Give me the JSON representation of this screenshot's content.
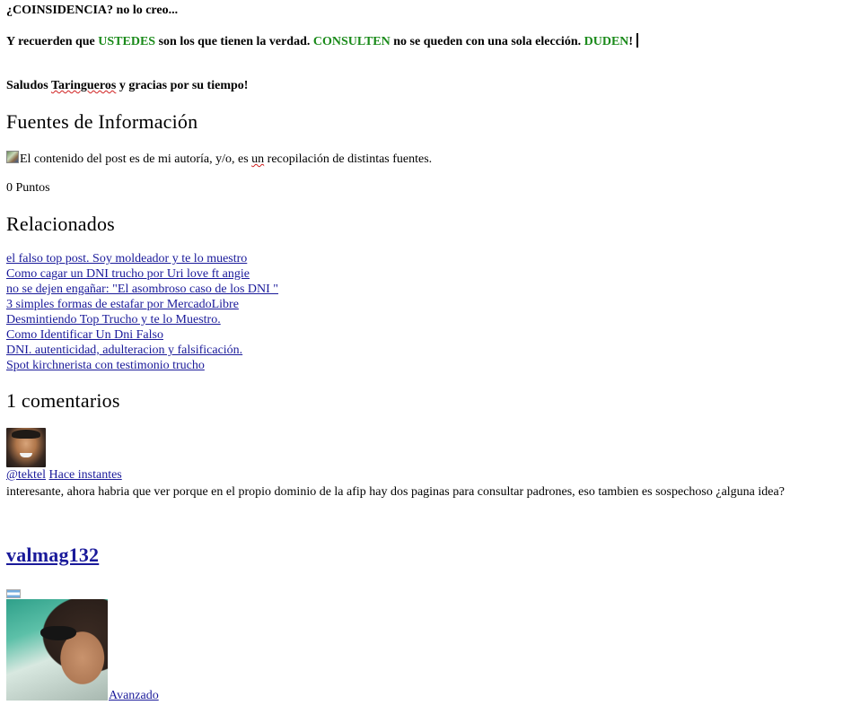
{
  "post": {
    "p1_a": "¿COINSIDENCIA?",
    "p1_b": " no lo creo...",
    "p2_a": "Y recuerden que ",
    "p2_ustedes": "USTEDES",
    "p2_b": " son los que tienen la verdad. ",
    "p2_consulten": "CONSULTEN",
    "p2_c": " no se queden con una sola elección. ",
    "p2_duden": "DUDEN",
    "p2_d": "!",
    "p3_a": "Saludos ",
    "p3_taringueros": "Taringueros",
    "p3_b": " y gracias por su tiempo!"
  },
  "fuentes": {
    "heading": "Fuentes de Información",
    "text_a": "El contenido del post es de mi autoría, y/o, es ",
    "text_un": "un",
    "text_b": " recopilación de distintas fuentes."
  },
  "puntos": "0 Puntos",
  "relacionados": {
    "heading": "Relacionados",
    "items": [
      "el falso top post. Soy moldeador y te lo muestro",
      "Como cagar un DNI trucho por Uri love ft angie",
      "no se dejen engañar: \"El asombroso caso de los DNI \"",
      "3 simples formas de estafar por MercadoLibre",
      "Desmintiendo Top Trucho y te lo Muestro.",
      "Como Identificar Un Dni Falso",
      "DNI. autenticidad, adulteracion y falsificación.",
      "Spot kirchnerista con testimonio trucho"
    ]
  },
  "comentarios": {
    "heading": "1 comentarios",
    "user": "@tektel",
    "time": "Hace instantes",
    "body": "interesante, ahora habria que ver porque en el propio dominio de la afip hay dos paginas para consultar padrones, eso tambien es sospechoso ¿alguna idea?"
  },
  "author": {
    "name": "valmag132",
    "level": "Avanzado"
  },
  "colors": {
    "highlight_green": "#1a8a1a",
    "link_blue": "#1a1a9a"
  }
}
